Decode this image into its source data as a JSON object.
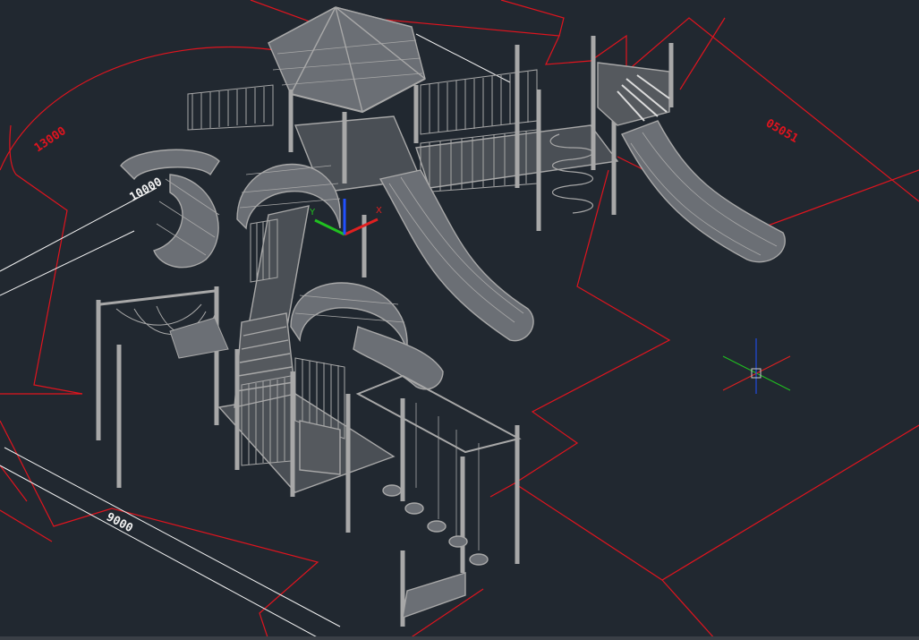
{
  "app": "AutoCAD",
  "drawing": "playground equipment 3D wireframe",
  "colors": {
    "background": "#212830",
    "boundary": "#e0141e",
    "dimension": "#f2f2f2",
    "model": "#a8a8a8",
    "axis_x": "#e02020",
    "axis_y": "#20c020",
    "axis_z": "#2050ff"
  },
  "dimensions": {
    "d1": "13000",
    "d2": "10000",
    "d3": "9000",
    "d4": "05051"
  },
  "ucs_icon": {
    "x_label": "X",
    "y_label": "Y"
  }
}
